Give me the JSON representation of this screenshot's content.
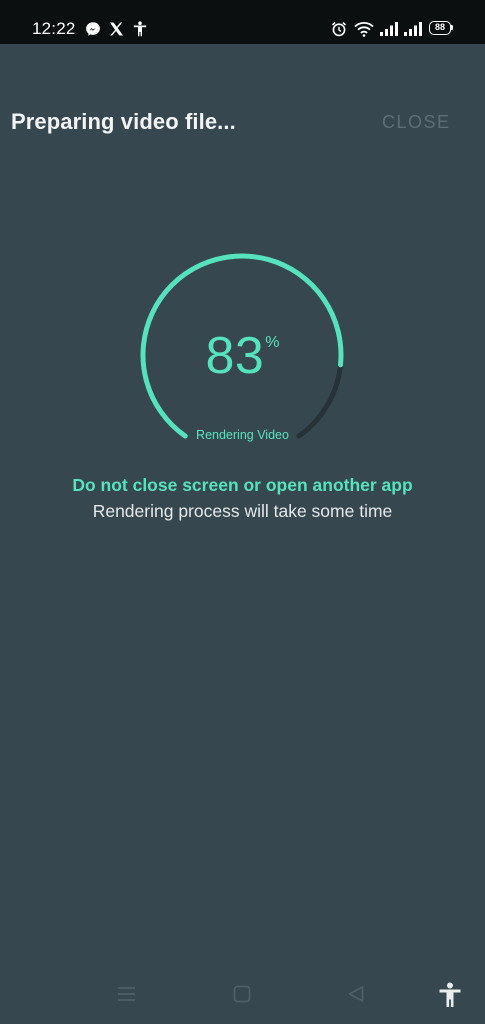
{
  "status_bar": {
    "time": "12:22",
    "battery": "88",
    "icons": [
      "messenger-icon",
      "x-icon",
      "accessibility-icon",
      "alarm-icon",
      "wifi-icon",
      "signal-icon",
      "signal-icon",
      "battery-icon"
    ]
  },
  "header": {
    "title": "Preparing video file...",
    "close_label": "CLOSE"
  },
  "progress": {
    "value": 83,
    "display_value": "83",
    "unit": "%",
    "caption": "Rendering Video",
    "colors": {
      "accent": "#57e2be",
      "track": "#263238",
      "background": "#37474f"
    }
  },
  "messages": {
    "warning": "Do not close screen or open another app",
    "info": "Rendering process will take some time"
  },
  "nav_bar": {
    "icons": [
      "menu-icon",
      "home-icon",
      "back-icon",
      "accessibility-icon"
    ]
  }
}
